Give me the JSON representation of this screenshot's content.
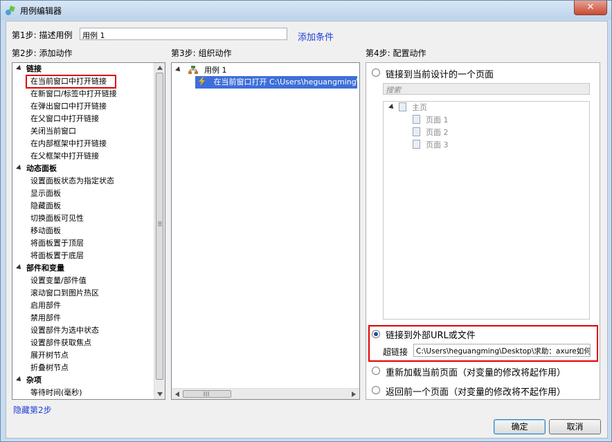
{
  "window": {
    "title": "用例编辑器",
    "close_label": "✕"
  },
  "step1": {
    "label": "第1步: 描述用例",
    "case_name": "用例 1",
    "add_condition": "添加条件"
  },
  "step2": {
    "title": "第2步: 添加动作",
    "groups": [
      {
        "label": "链接",
        "items": [
          "在当前窗口中打开链接",
          "在新窗口/标签中打开链接",
          "在弹出窗口中打开链接",
          "在父窗口中打开链接",
          "关闭当前窗口",
          "在内部框架中打开链接",
          "在父框架中打开链接"
        ]
      },
      {
        "label": "动态面板",
        "items": [
          "设置面板状态为指定状态",
          "显示面板",
          "隐藏面板",
          "切换面板可见性",
          "移动面板",
          "将面板置于顶层",
          "将面板置于底层"
        ]
      },
      {
        "label": "部件和变量",
        "items": [
          "设置变量/部件值",
          "滚动窗口到图片热区",
          "启用部件",
          "禁用部件",
          "设置部件为选中状态",
          "设置部件获取焦点",
          "展开树节点",
          "折叠树节点"
        ]
      },
      {
        "label": "杂项",
        "items": [
          "等待时间(毫秒)"
        ]
      }
    ],
    "hide_link": "隐藏第2步"
  },
  "step3": {
    "title": "第3步: 组织动作",
    "case_label": "用例 1",
    "action_label": "在当前窗口打开 C:\\Users\\heguangming\\Desktop\\求助：axure如何链"
  },
  "step4": {
    "title": "第4步: 配置动作",
    "option_current_page": "链接到当前设计的一个页面",
    "search_placeholder": "搜索",
    "pages": {
      "root": "主页",
      "children": [
        "页面 1",
        "页面 2",
        "页面 3"
      ]
    },
    "option_external": "链接到外部URL或文件",
    "hyperlink_label": "超链接",
    "hyperlink_value": "C:\\Users\\heguangming\\Desktop\\求助：axure如何链",
    "option_reload": "重新加载当前页面（对变量的修改将起作用）",
    "option_back": "返回前一个页面（对变量的修改将不起作用）"
  },
  "buttons": {
    "ok": "确定",
    "cancel": "取消"
  },
  "colors": {
    "highlight": "#e00000",
    "selection": "#3e6fd9",
    "link": "#1f3ed7"
  }
}
